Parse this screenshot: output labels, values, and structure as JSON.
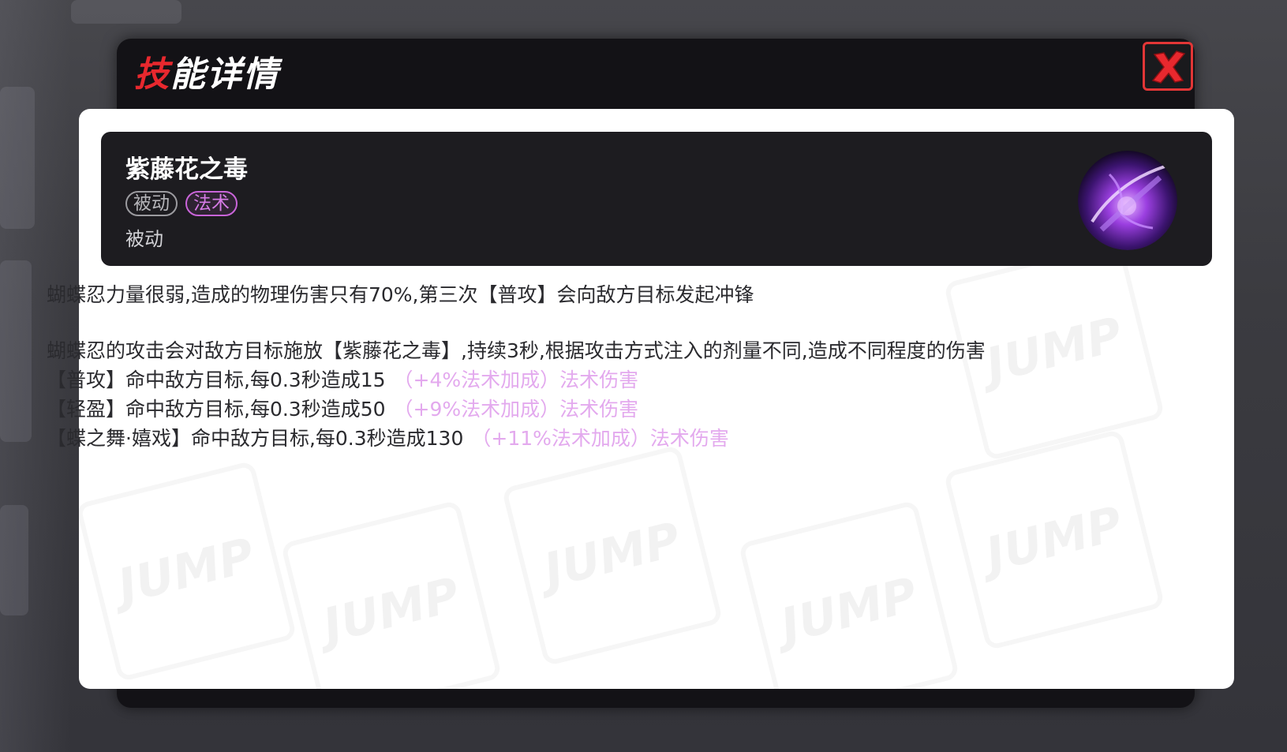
{
  "dialog": {
    "title_accent": "技",
    "title_rest": "能详情",
    "close_icon": "close-x-icon"
  },
  "skill": {
    "name": "紫藤花之毒",
    "tags": [
      "被动",
      "法术"
    ],
    "type_label": "被动",
    "icon": "poison-blade-skill-icon"
  },
  "description": {
    "line1": "蝴蝶忍力量很弱,造成的物理伤害只有70%,第三次【普攻】会向敌方目标发起冲锋",
    "line2": "蝴蝶忍的攻击会对敌方目标施放【紫藤花之毒】,持续3秒,根据攻击方式注入的剂量不同,造成不同程度的伤害",
    "effects": [
      {
        "text": "【普攻】命中敌方目标,每0.3秒造成15",
        "bonus": "（+4%法术加成）法术伤害"
      },
      {
        "text": "【轻盈】命中敌方目标,每0.3秒造成50",
        "bonus": "（+9%法术加成）法术伤害"
      },
      {
        "text": "【蝶之舞·嬉戏】命中敌方目标,每0.3秒造成130",
        "bonus": "（+11%法术加成）法术伤害"
      }
    ]
  },
  "colors": {
    "title_accent": "#e8282e",
    "close_border": "#e23636",
    "magic_tag": "#d67be6",
    "bonus_text": "#e3a9ee",
    "card_bg": "#1d1c20"
  }
}
